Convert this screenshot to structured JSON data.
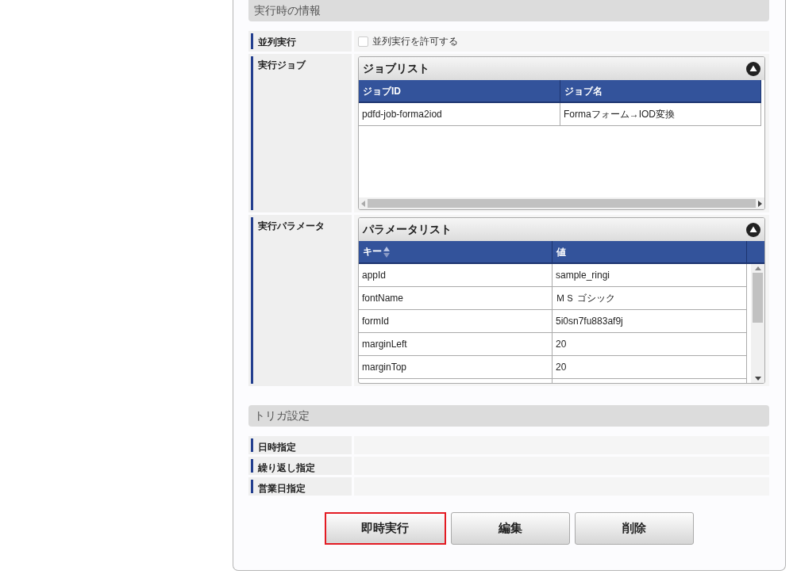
{
  "sections": [
    {
      "title": "実行時の情報",
      "rows": [
        {
          "kind": "checkbox",
          "label": "並列実行",
          "checkbox": {
            "label": "並列実行を許可する",
            "checked": false
          }
        },
        {
          "kind": "grid",
          "label": "実行ジョブ",
          "grid": {
            "title": "ジョブリスト",
            "scroll_x": true,
            "scroll_y": false,
            "columns": [
              {
                "label": "ジョブID",
                "sortable": false
              },
              {
                "label": "ジョブ名",
                "sortable": false
              }
            ],
            "rows": [
              [
                "pdfd-job-forma2iod",
                "Formaフォーム→IOD変換"
              ]
            ]
          }
        },
        {
          "kind": "grid",
          "label": "実行パラメータ",
          "grid": {
            "title": "パラメータリスト",
            "scroll_x": false,
            "scroll_y": true,
            "columns": [
              {
                "label": "キー",
                "sortable": true
              },
              {
                "label": "値",
                "sortable": false
              }
            ],
            "rows": [
              [
                "appId",
                "sample_ringi"
              ],
              [
                "fontName",
                "ＭＳ ゴシック"
              ],
              [
                "formId",
                "5i0sn7fu883af9j"
              ],
              [
                "marginLeft",
                "20"
              ],
              [
                "marginTop",
                "20"
              ]
            ]
          }
        }
      ]
    },
    {
      "title": "トリガ設定",
      "rows": [
        {
          "kind": "empty",
          "label": "日時指定"
        },
        {
          "kind": "empty",
          "label": "繰り返し指定"
        },
        {
          "kind": "empty",
          "label": "営業日指定"
        }
      ]
    }
  ],
  "buttons": [
    {
      "label": "即時実行",
      "highlighted": true
    },
    {
      "label": "編集",
      "highlighted": false
    },
    {
      "label": "削除",
      "highlighted": false
    }
  ]
}
